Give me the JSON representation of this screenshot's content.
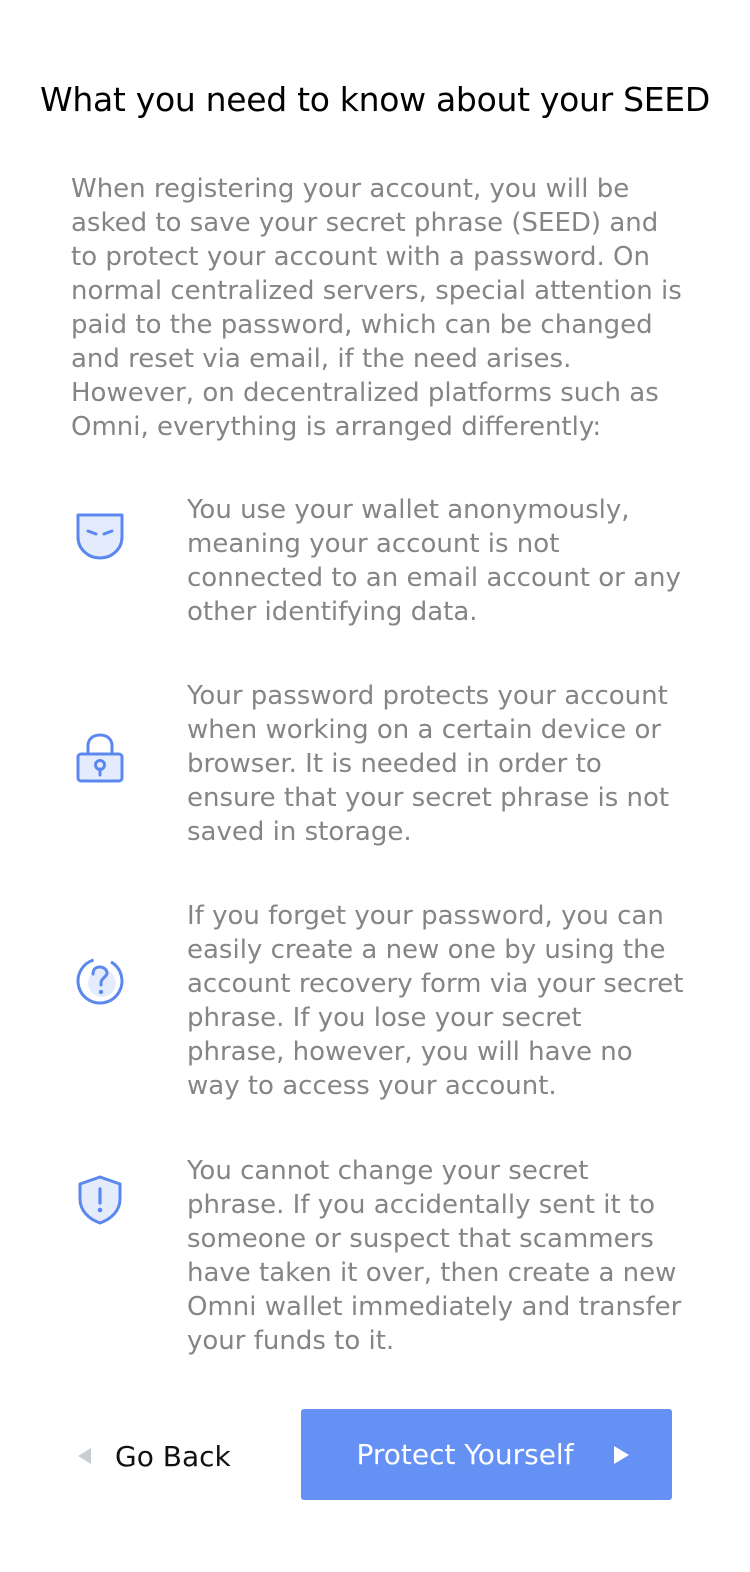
{
  "page": {
    "title": "What you need to know about your SEED",
    "intro": "When registering your account, you will be asked to save your secret phrase (SEED) and to protect your account with a password. On normal centralized servers, special attention is paid to the password, which can be changed and reset via email, if the need arises. However, on decentralized platforms such as Omni, everything is arranged differently:"
  },
  "items": [
    {
      "icon": "mask-icon",
      "text": "You use your wallet anonymously, meaning your account is not connected to an email account or any other identifying data."
    },
    {
      "icon": "lock-icon",
      "text": "Your password protects your account when working on a certain device or browser. It is needed in order to ensure that your secret phrase is not saved in storage."
    },
    {
      "icon": "question-icon",
      "text": "If you forget your password, you can easily create a new one by using the account recovery form via your secret phrase. If you lose your secret phrase, however, you will have no way to access your account."
    },
    {
      "icon": "shield-alert-icon",
      "text": "You cannot change your secret phrase. If you accidentally sent it to someone or suspect that scammers have taken it over, then create a new Omni wallet immediately and transfer your funds to it."
    }
  ],
  "actions": {
    "back_label": "Go Back",
    "primary_label": "Protect Yourself"
  },
  "colors": {
    "accent": "#6591f5",
    "icon_stroke": "#5b88ef",
    "icon_fill": "#e3ebfd",
    "body_text": "#858585",
    "title_text": "#000000",
    "back_arrow": "#c8ccd3"
  }
}
